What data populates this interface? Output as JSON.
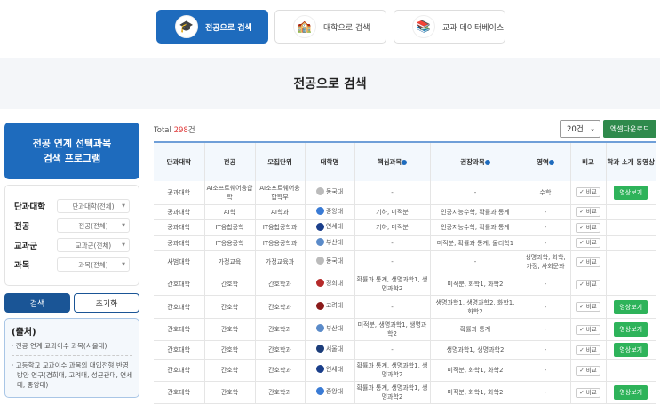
{
  "nav": [
    {
      "label": "전공으로 검색",
      "icon": "graduation-cap-icon",
      "active": true
    },
    {
      "label": "대학으로 검색",
      "icon": "school-icon",
      "active": false
    },
    {
      "label": "교과 데이터베이스",
      "icon": "books-icon",
      "active": false
    }
  ],
  "page_title": "전공으로 검색",
  "sidebar": {
    "program_title_1": "전공 연계 선택과목",
    "program_title_2": "검색 프로그램",
    "filters": [
      {
        "label": "단과대학",
        "value": "단과대학(전체)"
      },
      {
        "label": "전공",
        "value": "전공(전체)"
      },
      {
        "label": "교과군",
        "value": "교과군(전체)"
      },
      {
        "label": "과목",
        "value": "과목(전체)"
      }
    ],
    "search_label": "검색",
    "reset_label": "초기화",
    "source_title": "(출처)",
    "source_items": [
      "전공 연계 교과이수 과목(서울대)",
      "고등학교 교과이수 과목의 대입전형 반영 방안 연구(경희대, 고려대, 성균관대, 연세대, 중앙대)"
    ]
  },
  "total_prefix": "Total ",
  "total_count": "298",
  "total_suffix": "건",
  "page_size": "20건",
  "excel_label": "엑셀다운로드",
  "columns": [
    "단과대학",
    "전공",
    "모집단위",
    "대학명",
    "핵심과목",
    "권장과목",
    "영역",
    "비교",
    "학과 소개 동영상"
  ],
  "compare_label": "✓ 비교",
  "video_label": "영상보기",
  "colors": {
    "primary": "#1e6bbd",
    "excel": "#2f8a4c",
    "video": "#2eb35a",
    "total": "#e03a3a"
  },
  "rows": [
    {
      "college": "공과대학",
      "major": "AI소프트웨어융합학",
      "unit": "AI소프트웨어융합학부",
      "univ": "동국대",
      "core": "-",
      "rec": "-",
      "area": "수학",
      "video": true
    },
    {
      "college": "공과대학",
      "major": "AI학",
      "unit": "AI학과",
      "univ": "중앙대",
      "core": "기하, 미적분",
      "rec": "인공지능수학, 확률과 통계",
      "area": "-",
      "video": false
    },
    {
      "college": "공과대학",
      "major": "IT융합공학",
      "unit": "IT융합공학과",
      "univ": "연세대",
      "core": "기하, 미적분",
      "rec": "인공지능수학, 확률과 통계",
      "area": "-",
      "video": false
    },
    {
      "college": "공과대학",
      "major": "IT응용공학",
      "unit": "IT응용공학과",
      "univ": "부산대",
      "core": "-",
      "rec": "미적분, 확률과 통계, 물리학1",
      "area": "-",
      "video": false
    },
    {
      "college": "사범대학",
      "major": "가정교육",
      "unit": "가정교육과",
      "univ": "동국대",
      "core": "-",
      "rec": "-",
      "area": "생명과학, 화학, 가정, 사회문화",
      "video": false
    },
    {
      "college": "간호대학",
      "major": "간호학",
      "unit": "간호학과",
      "univ": "경희대",
      "core": "확률과 통계, 생명과학1, 생명과학2",
      "rec": "미적분, 화학1, 화학2",
      "area": "-",
      "video": false
    },
    {
      "college": "간호대학",
      "major": "간호학",
      "unit": "간호학과",
      "univ": "고려대",
      "core": "-",
      "rec": "생명과학1, 생명과학2, 화학1, 화학2",
      "area": "-",
      "video": true
    },
    {
      "college": "간호대학",
      "major": "간호학",
      "unit": "간호학과",
      "univ": "부산대",
      "core": "미적분, 생명과학1, 생명과학2",
      "rec": "확률과 통계",
      "area": "-",
      "video": true
    },
    {
      "college": "간호대학",
      "major": "간호학",
      "unit": "간호학과",
      "univ": "서울대",
      "core": "-",
      "rec": "생명과학1, 생명과학2",
      "area": "-",
      "video": true
    },
    {
      "college": "간호대학",
      "major": "간호학",
      "unit": "간호학과",
      "univ": "연세대",
      "core": "확률과 통계, 생명과학1, 생명과학2",
      "rec": "미적분, 화학1, 화학2",
      "area": "-",
      "video": false
    },
    {
      "college": "간호대학",
      "major": "간호학",
      "unit": "간호학과",
      "univ": "중앙대",
      "core": "확률과 통계, 생명과학1, 생명과학2",
      "rec": "미적분, 화학1, 화학2",
      "area": "-",
      "video": true
    }
  ]
}
